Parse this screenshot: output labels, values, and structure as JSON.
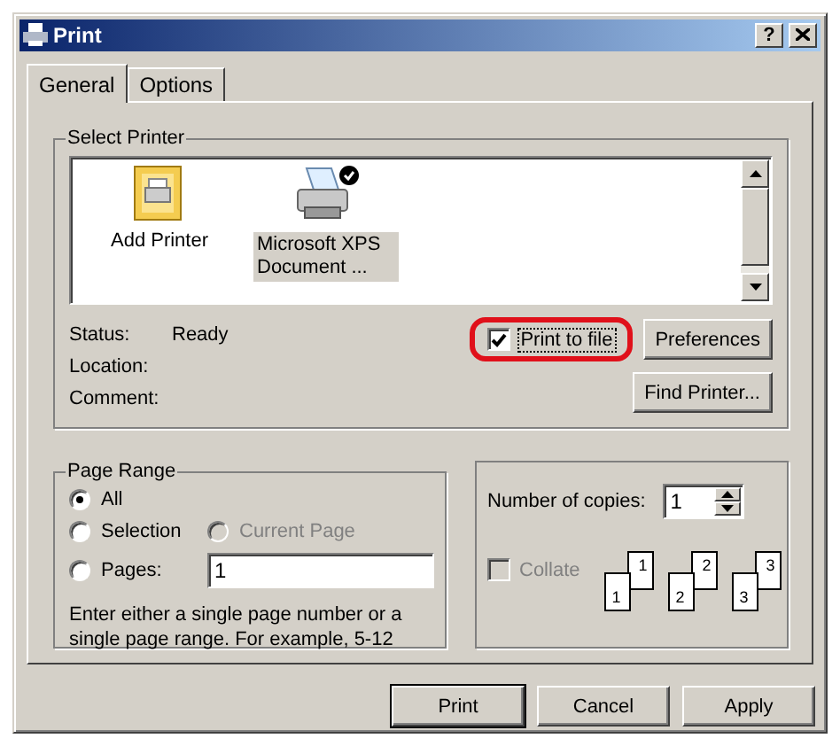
{
  "window": {
    "title": "Print",
    "help_button": "?"
  },
  "tabs": [
    {
      "label": "General",
      "selected": true
    },
    {
      "label": "Options",
      "selected": false
    }
  ],
  "select_printer": {
    "title": "Select Printer",
    "printers": [
      {
        "label": "Add Printer",
        "kind": "add",
        "selected": false
      },
      {
        "label": "Microsoft XPS Document ...",
        "kind": "printer",
        "selected": true
      }
    ],
    "status_rows": [
      {
        "label": "Status:",
        "value": "Ready"
      },
      {
        "label": "Location:"
      },
      {
        "label": "Comment:"
      }
    ],
    "print_to_file": {
      "label": "Print to file",
      "checked": true,
      "highlighted": true
    },
    "preferences_button": "Preferences",
    "find_printer_button": "Find Printer..."
  },
  "page_range": {
    "title": "Page Range",
    "options": [
      {
        "label": "All",
        "selected": true,
        "disabled": false
      },
      {
        "label": "Selection",
        "selected": false,
        "disabled": false
      },
      {
        "label": "Current Page",
        "selected": false,
        "disabled": true
      },
      {
        "label": "Pages:",
        "selected": false,
        "disabled": false
      }
    ],
    "pages_value": "1",
    "hint": "Enter either a single page number or a single page range.  For example, 5-12"
  },
  "copies": {
    "label": "Number of copies:",
    "value": "1",
    "collate": {
      "label": "Collate",
      "checked": false,
      "disabled": true
    },
    "collate_pages": [
      "1",
      "1",
      "2",
      "2",
      "3",
      "3"
    ]
  },
  "buttons": [
    {
      "label": "Print",
      "default": true
    },
    {
      "label": "Cancel",
      "default": false
    },
    {
      "label": "Apply",
      "default": false
    }
  ]
}
